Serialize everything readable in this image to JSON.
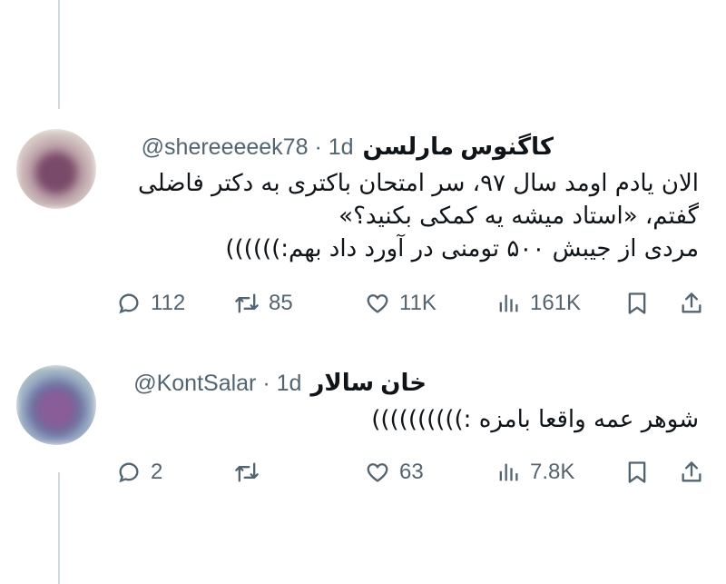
{
  "tweets": [
    {
      "display_name": "کاگنوس مارلسن",
      "handle": "@shereeeeek78 · 1d",
      "text_lines": [
        "الان یادم اومد سال ۹۷، سر امتحان باکتری به دکتر فاضلی",
        "گفتم، «استاد میشه یه کمکی بکنید؟»",
        "مردی از جیبش ۵۰۰ تومنی در آورد داد بهم:))))))"
      ],
      "replies": "112",
      "retweets": "85",
      "likes": "11K",
      "views": "161K"
    },
    {
      "display_name": "خان سالار",
      "handle": "@KontSalar · 1d",
      "text_lines": [
        "شوهر عمه واقعا بامزه :))))))))))"
      ],
      "replies": "2",
      "retweets": "",
      "likes": "63",
      "views": "7.8K"
    }
  ],
  "icons": {
    "reply": "reply-icon",
    "retweet": "retweet-icon",
    "like": "heart-icon",
    "views": "views-icon",
    "bookmark": "bookmark-icon",
    "share": "share-icon"
  },
  "colors": {
    "text": "#0f1419",
    "secondary": "#536471",
    "thread_line": "#cfd9de"
  }
}
